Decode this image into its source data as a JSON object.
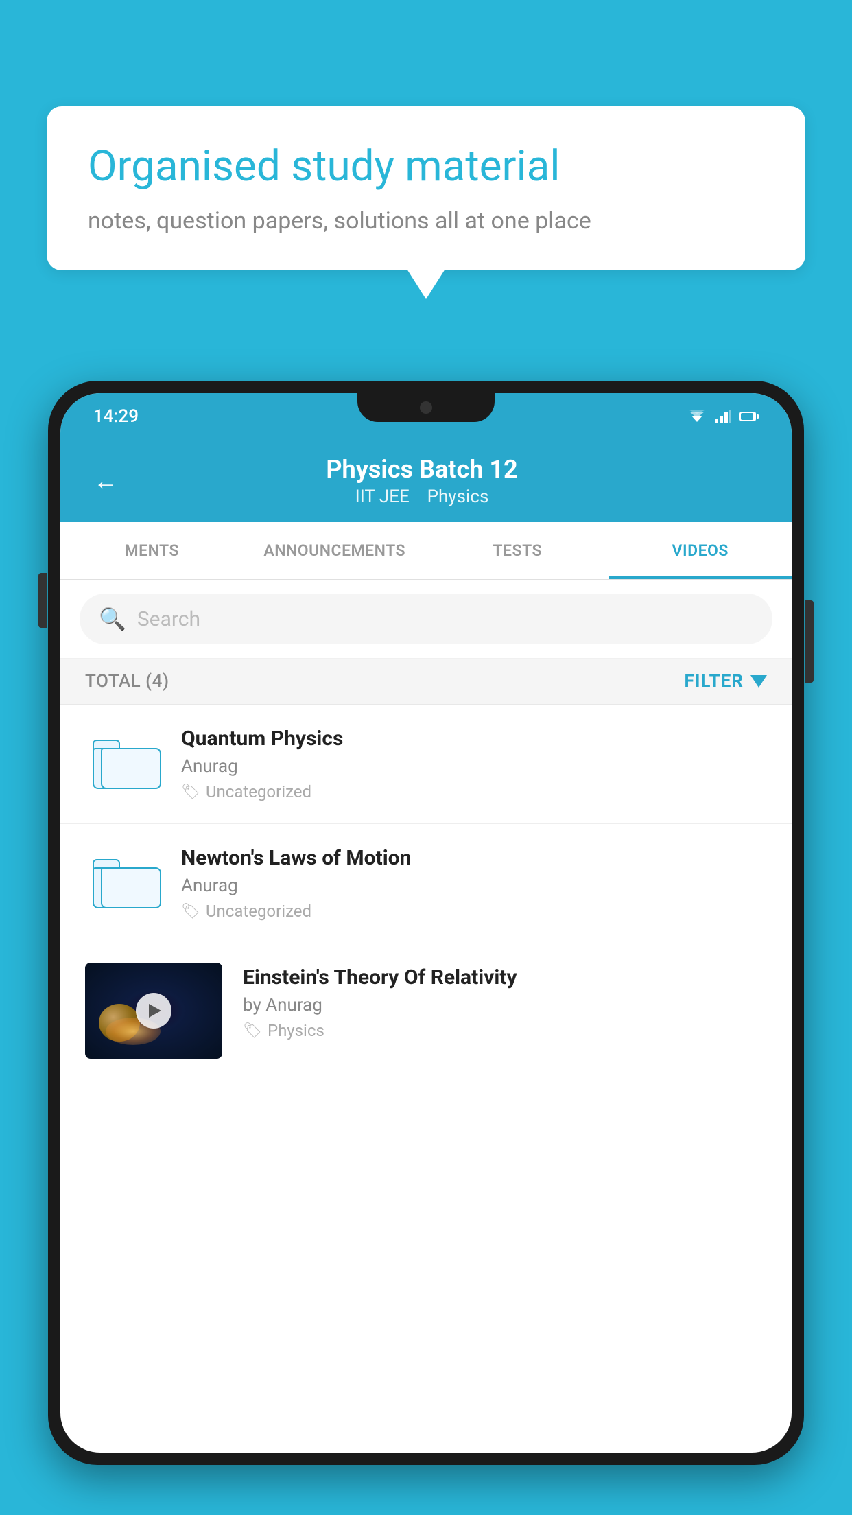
{
  "background_color": "#29B6D8",
  "speech_bubble": {
    "headline": "Organised study material",
    "subtext": "notes, question papers, solutions all at one place"
  },
  "phone": {
    "status_bar": {
      "time": "14:29"
    },
    "header": {
      "back_label": "←",
      "title": "Physics Batch 12",
      "subtitle_parts": [
        "IIT JEE",
        "Physics"
      ]
    },
    "tabs": [
      {
        "label": "MENTS",
        "active": false
      },
      {
        "label": "ANNOUNCEMENTS",
        "active": false
      },
      {
        "label": "TESTS",
        "active": false
      },
      {
        "label": "VIDEOS",
        "active": true
      }
    ],
    "search": {
      "placeholder": "Search"
    },
    "filter_bar": {
      "total_label": "TOTAL (4)",
      "filter_label": "FILTER"
    },
    "videos": [
      {
        "title": "Quantum Physics",
        "author": "Anurag",
        "tag": "Uncategorized",
        "type": "folder"
      },
      {
        "title": "Newton's Laws of Motion",
        "author": "Anurag",
        "tag": "Uncategorized",
        "type": "folder"
      },
      {
        "title": "Einstein's Theory Of Relativity",
        "author": "by Anurag",
        "tag": "Physics",
        "type": "video"
      }
    ]
  }
}
